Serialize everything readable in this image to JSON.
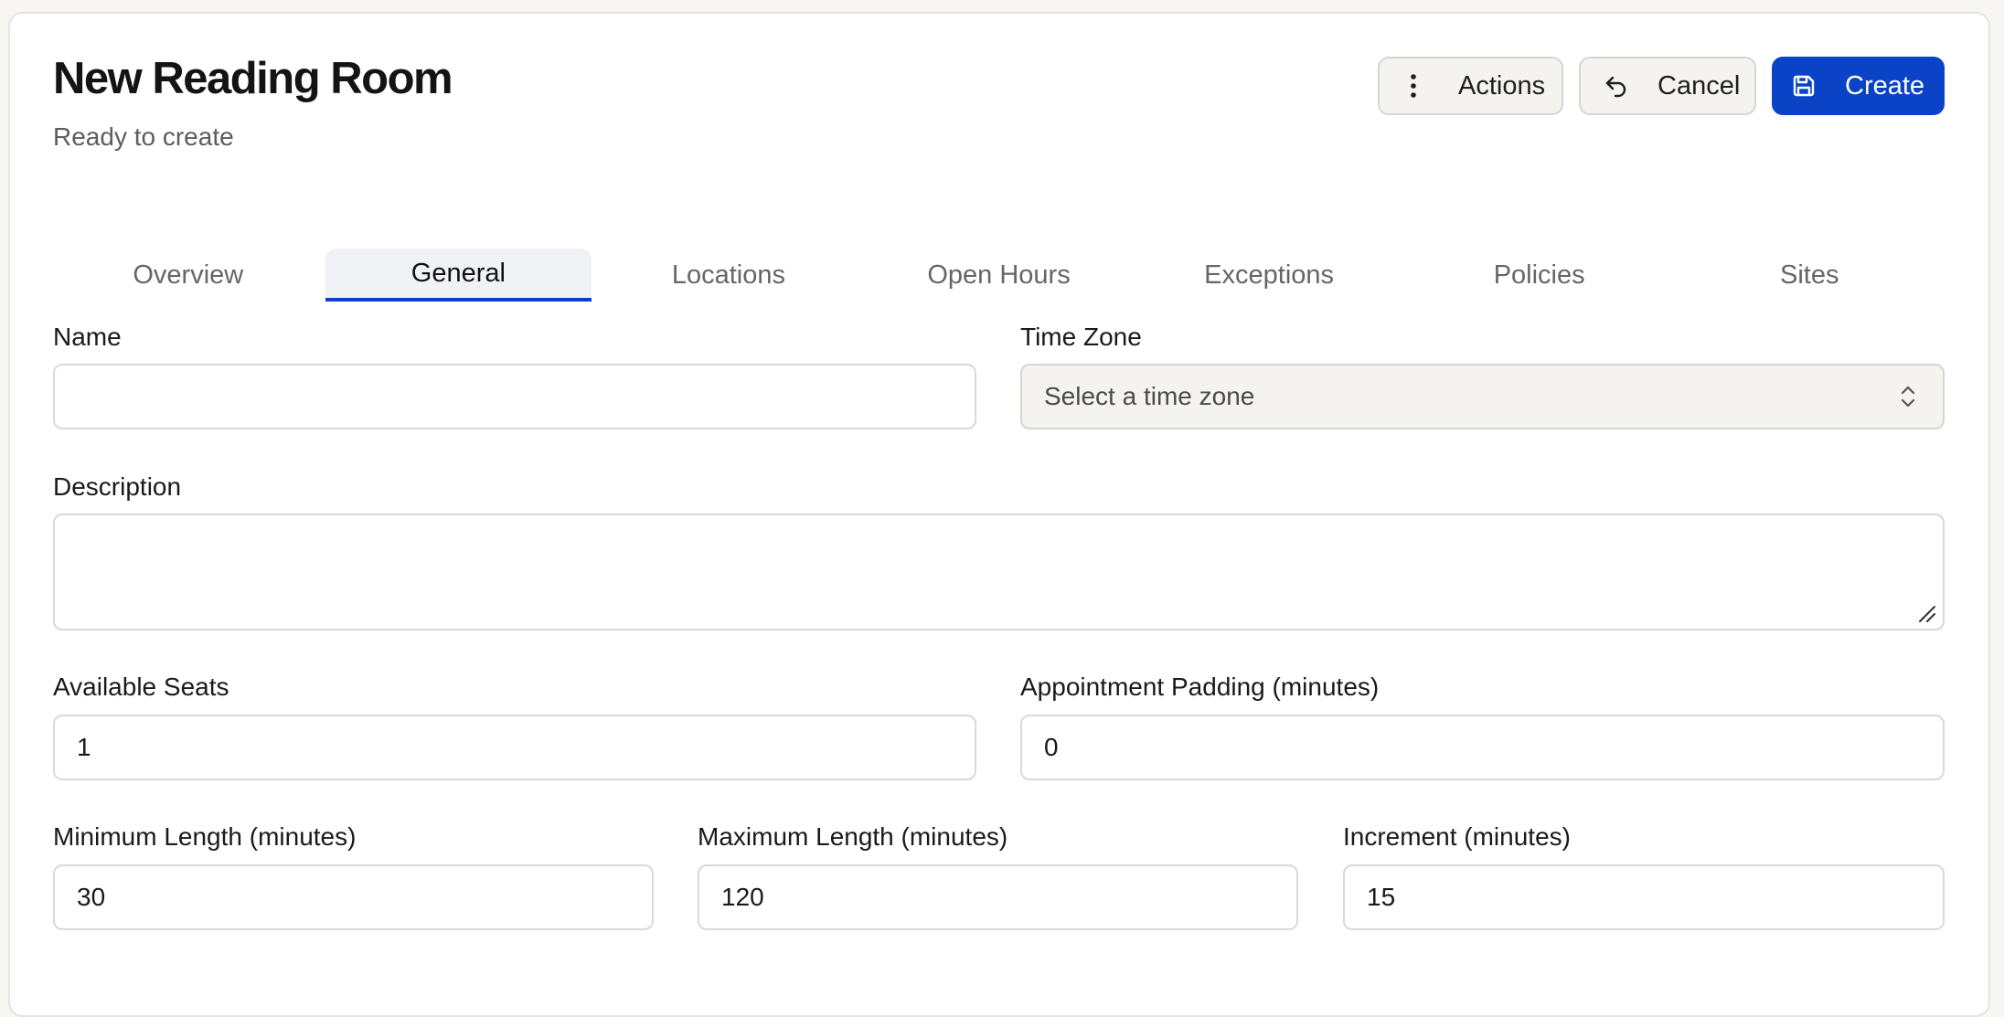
{
  "header": {
    "title": "New Reading Room",
    "subtitle": "Ready to create"
  },
  "actions": {
    "actions_label": "Actions",
    "cancel_label": "Cancel",
    "create_label": "Create"
  },
  "tabs": [
    {
      "label": "Overview",
      "active": false
    },
    {
      "label": "General",
      "active": true
    },
    {
      "label": "Locations",
      "active": false
    },
    {
      "label": "Open Hours",
      "active": false
    },
    {
      "label": "Exceptions",
      "active": false
    },
    {
      "label": "Policies",
      "active": false
    },
    {
      "label": "Sites",
      "active": false
    }
  ],
  "form": {
    "name": {
      "label": "Name",
      "value": ""
    },
    "time_zone": {
      "label": "Time Zone",
      "placeholder": "Select a time zone"
    },
    "description": {
      "label": "Description",
      "value": ""
    },
    "available_seats": {
      "label": "Available Seats",
      "value": "1"
    },
    "appointment_padding": {
      "label": "Appointment Padding (minutes)",
      "value": "0"
    },
    "minimum_length": {
      "label": "Minimum Length (minutes)",
      "value": "30"
    },
    "maximum_length": {
      "label": "Maximum Length (minutes)",
      "value": "120"
    },
    "increment": {
      "label": "Increment (minutes)",
      "value": "15"
    }
  },
  "icons": {
    "actions": "more-vertical-icon",
    "cancel": "undo-icon",
    "create": "save-icon",
    "select": "chevron-up-down-icon"
  },
  "colors": {
    "primary": "#0b43c7",
    "secondary_bg": "#f4f3ef",
    "border": "#d9d9d6"
  }
}
